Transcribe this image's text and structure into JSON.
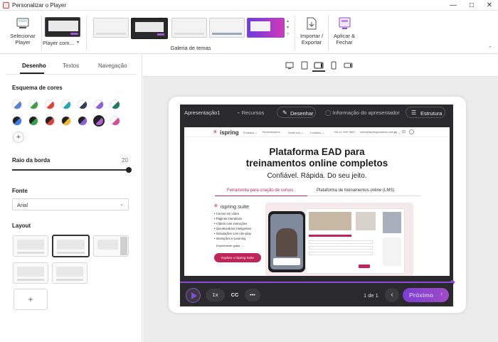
{
  "window": {
    "title": "Personalizar o Player",
    "controls": {
      "minimize": "—",
      "maximize": "□",
      "close": "✕"
    }
  },
  "ribbon": {
    "select_player_label": "Selecionar Player",
    "player_combo_label": "Player com...",
    "gallery_label": "Galeria de temas",
    "import_export_label": "Importar / Exportar",
    "apply_close_label": "Aplicar & Fechar"
  },
  "left": {
    "tabs": [
      "Desenho",
      "Textos",
      "Navegação"
    ],
    "color_scheme_title": "Esquema de cores",
    "swatches_row1": [
      {
        "a": "#ffffff",
        "b": "#5b7fd6"
      },
      {
        "a": "#ffffff",
        "b": "#3aa043"
      },
      {
        "a": "#ffffff",
        "b": "#e0413a"
      },
      {
        "a": "#ffffff",
        "b": "#1fa6b8"
      },
      {
        "a": "#ffffff",
        "b": "#2f3d55"
      },
      {
        "a": "#ffffff",
        "b": "#8c5fd6"
      },
      {
        "a": "#ffffff",
        "b": "#1e7a63"
      }
    ],
    "swatches_row2": [
      {
        "a": "#222222",
        "b": "#3f7be0"
      },
      {
        "a": "#222222",
        "b": "#31a34a"
      },
      {
        "a": "#222222",
        "b": "#e0413a"
      },
      {
        "a": "#222222",
        "b": "#f2b928"
      },
      {
        "a": "#222222",
        "b": "#8c5fd6"
      },
      {
        "a": "#222222",
        "b": "#b35fd6"
      },
      {
        "a": "#ffffff",
        "b": "#d64e9a"
      }
    ],
    "add_symbol": "+",
    "border_radius_title": "Raio da borda",
    "border_radius_value": "20",
    "border_radius_fraction": 1.0,
    "font_title": "Fonte",
    "font_value": "Arial",
    "layout_title": "Layout",
    "layout_add_symbol": "+"
  },
  "player": {
    "slide_name": "Apresentação1",
    "tabs": [
      "Recursos",
      "Desenhar",
      "Informação do apresentador",
      "Estrutura"
    ],
    "speed": "1x",
    "cc": "CC",
    "more": "•••",
    "page": "1 de 1",
    "next": "Próximo"
  },
  "slide": {
    "logo": "ispring",
    "nav": [
      "Produtos ⌄",
      "Revendedores",
      "Sobre nós ⌄",
      "Contatos ⌄",
      "+55 11 3957 8867",
      "sales@ispringsolutions.com.br",
      "PT ⌄"
    ],
    "headline_1": "Plataforma EAD para",
    "headline_2": "treinamentos online completos",
    "subline": "Confiável. Rápida. Do seu jeito.",
    "tab_1": "Ferramenta para criação de cursos",
    "tab_2": "Plataforma de treinamentos online (LMS)",
    "product_name": "ispring suite",
    "features": [
      "Cursos em vídeo",
      "Páginas interativas",
      "Vídeos com instruções",
      "Questionários inteligentes",
      "Simulações com role-play",
      "Interações e-Learning"
    ],
    "trial_link": "Experimente grátis →",
    "cta": "Explore o iSpring Suite"
  }
}
